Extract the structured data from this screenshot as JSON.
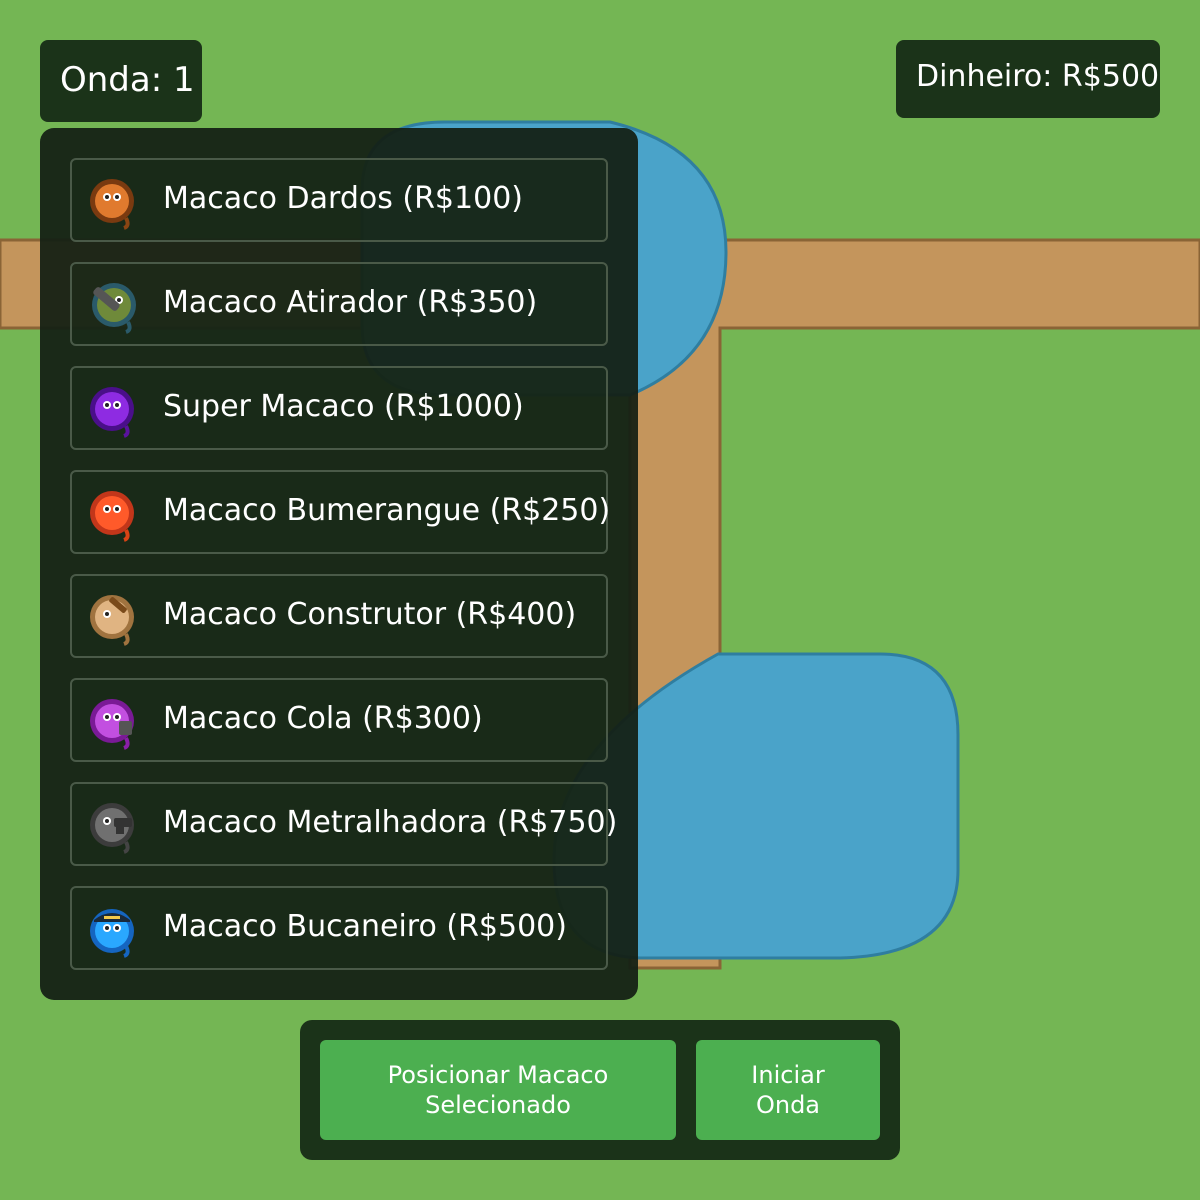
{
  "hud": {
    "wave_text": "Onda: 1",
    "money_text": "Dinheiro: R$500"
  },
  "shop": {
    "items": [
      {
        "label": "Macaco Dardos (R$100)",
        "icon": "dart-monkey-icon",
        "color": "#c9651f"
      },
      {
        "label": "Macaco Atirador (R$350)",
        "icon": "sniper-monkey-icon",
        "color": "#5a7a3a"
      },
      {
        "label": "Super Macaco (R$1000)",
        "icon": "super-monkey-icon",
        "color": "#7b1fd6"
      },
      {
        "label": "Macaco Bumerangue (R$250)",
        "icon": "boomerang-monkey-icon",
        "color": "#ff5722"
      },
      {
        "label": "Macaco Construtor (R$400)",
        "icon": "engineer-monkey-icon",
        "color": "#d4a373"
      },
      {
        "label": "Macaco Cola (R$300)",
        "icon": "glue-monkey-icon",
        "color": "#a632c9"
      },
      {
        "label": "Macaco Metralhadora (R$750)",
        "icon": "machine-gun-monkey-icon",
        "color": "#666666"
      },
      {
        "label": "Macaco Bucaneiro (R$500)",
        "icon": "buccaneer-monkey-icon",
        "color": "#1e90ff"
      }
    ]
  },
  "actions": {
    "place_label": "Posicionar Macaco Selecionado",
    "start_label": "Iniciar Onda"
  },
  "colors": {
    "grass": "#74b654",
    "path": "#c4955c",
    "water": "#4aa3c9",
    "button": "#4caf50",
    "panel": "#1b3319"
  }
}
